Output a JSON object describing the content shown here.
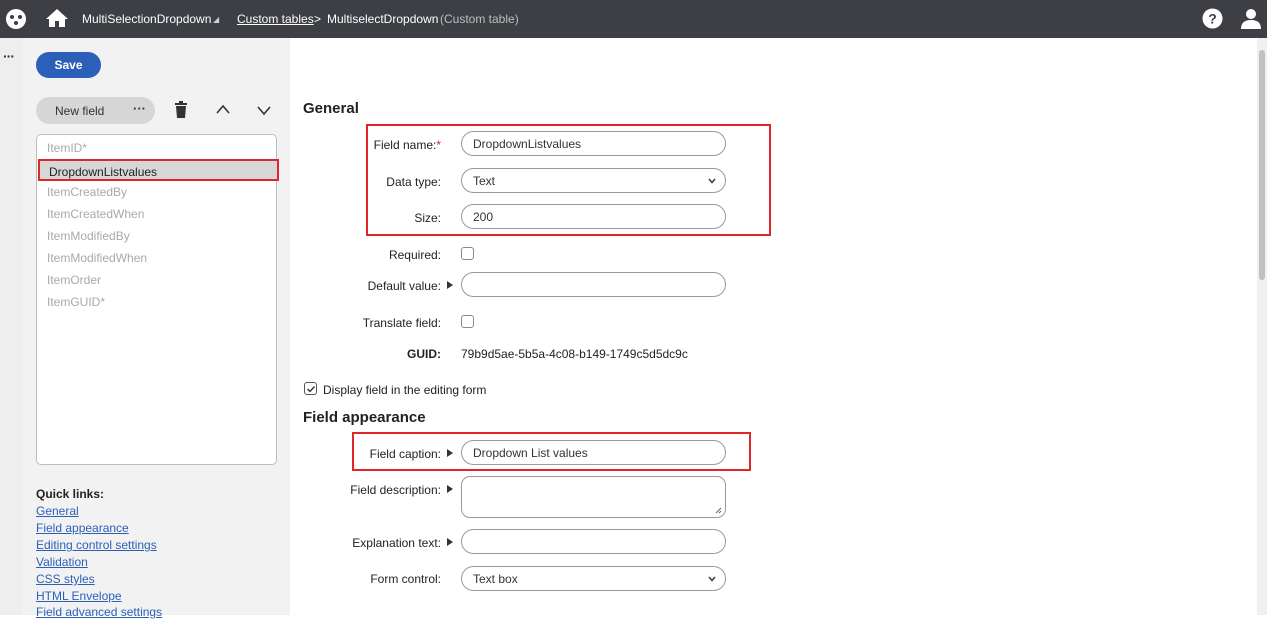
{
  "topbar": {
    "app_name": "MultiSelectionDropdown",
    "caret": "◢",
    "breadcrumb_link": "Custom tables",
    "separator": ">",
    "current_page": "MultiselectDropdown",
    "current_type": "(Custom table)"
  },
  "rail": {
    "menu": "···"
  },
  "toolbar": {
    "save_label": "Save",
    "new_field_label": "New field",
    "more_label": "···"
  },
  "field_list": {
    "items": [
      {
        "label": "ItemID*",
        "selected": false
      },
      {
        "label": "DropdownListvalues",
        "selected": true
      },
      {
        "label": "ItemCreatedBy",
        "selected": false
      },
      {
        "label": "ItemCreatedWhen",
        "selected": false
      },
      {
        "label": "ItemModifiedBy",
        "selected": false
      },
      {
        "label": "ItemModifiedWhen",
        "selected": false
      },
      {
        "label": "ItemOrder",
        "selected": false
      },
      {
        "label": "ItemGUID*",
        "selected": false
      }
    ]
  },
  "quick_links": {
    "title": "Quick links:",
    "links": [
      "General",
      "Field appearance",
      "Editing control settings",
      "Validation",
      "CSS styles",
      "HTML Envelope",
      "Field advanced settings"
    ]
  },
  "general": {
    "title": "General",
    "field_name_label": "Field name:",
    "field_name_required": "*",
    "field_name_value": "DropdownListvalues",
    "data_type_label": "Data type:",
    "data_type_value": "Text",
    "size_label": "Size:",
    "size_value": "200",
    "required_label": "Required:",
    "required_checked": false,
    "default_value_label": "Default value:",
    "default_value_value": "",
    "translate_label": "Translate field:",
    "translate_checked": false,
    "guid_label": "GUID:",
    "guid_value": "79b9d5ae-5b5a-4c08-b149-1749c5d5dc9c",
    "display_label": "Display field in the editing form",
    "display_checked": true
  },
  "appearance": {
    "title": "Field appearance",
    "caption_label": "Field caption:",
    "caption_value": "Dropdown List values",
    "description_label": "Field description:",
    "description_value": "",
    "explanation_label": "Explanation text:",
    "explanation_value": "",
    "form_control_label": "Form control:",
    "form_control_value": "Text box"
  },
  "colors": {
    "accent": "#2c5fb8",
    "topbar": "#3d3f45",
    "highlight": "#e0252b"
  }
}
